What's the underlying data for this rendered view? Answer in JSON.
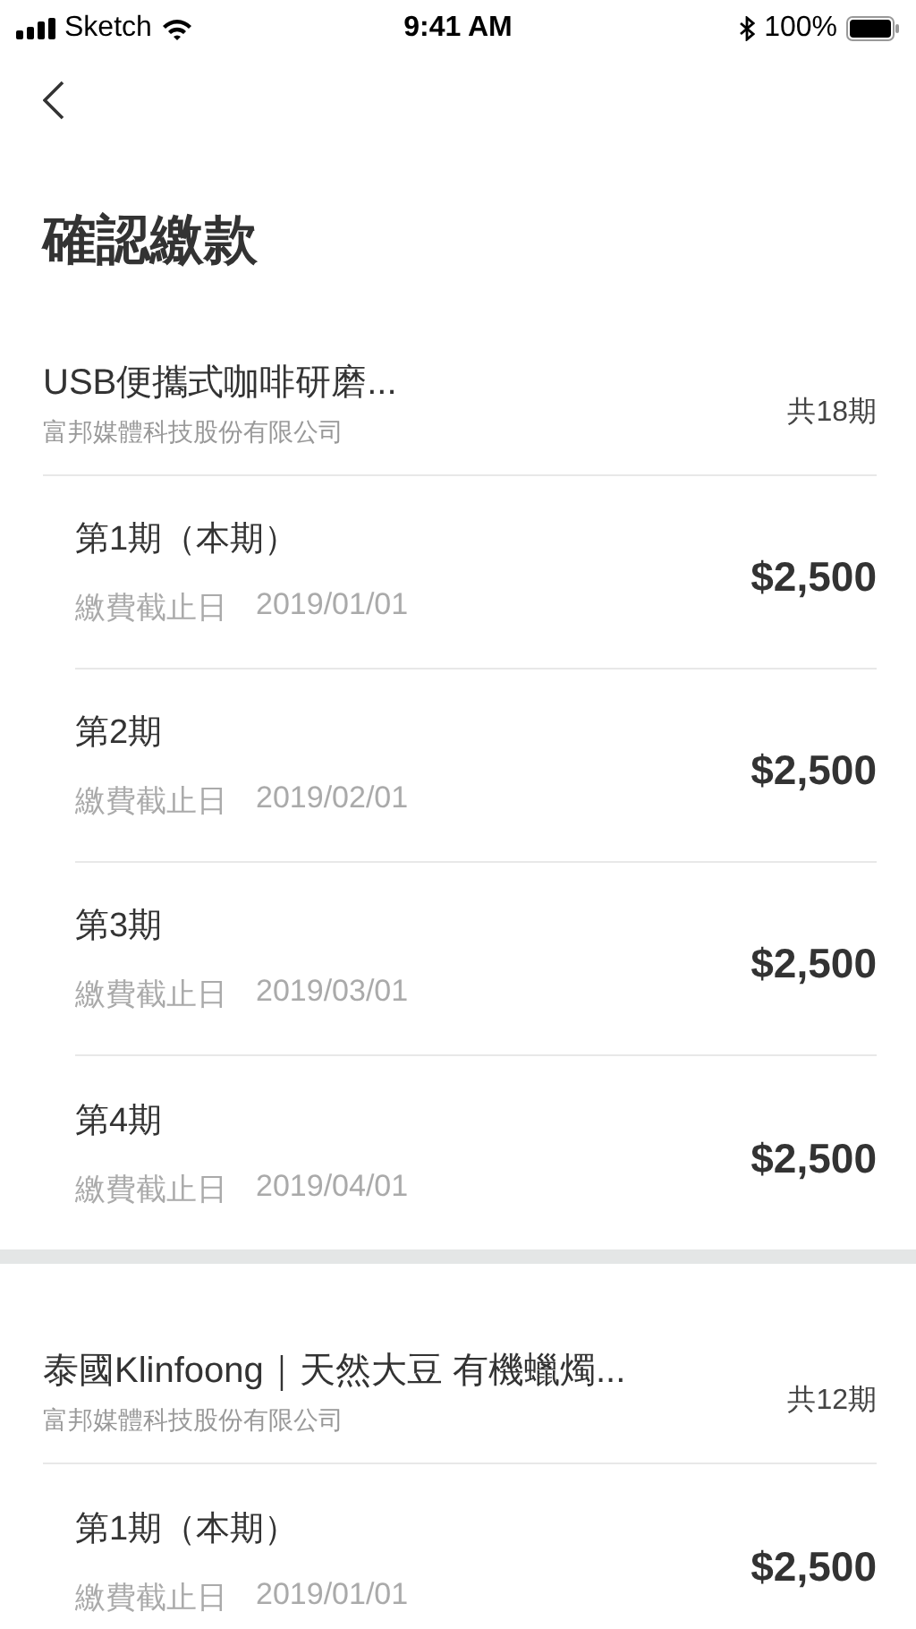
{
  "status_bar": {
    "carrier": "Sketch",
    "time": "9:41 AM",
    "battery": "100%"
  },
  "title": "確認繳款",
  "orders": [
    {
      "name": "USB便攜式咖啡研磨...",
      "merchant": "富邦媒體科技股份有限公司",
      "total": "共18期",
      "installments": [
        {
          "label": "第1期（本期）",
          "due_label": "繳費截止日",
          "due_date": "2019/01/01",
          "amount": "$2,500"
        },
        {
          "label": "第2期",
          "due_label": "繳費截止日",
          "due_date": "2019/02/01",
          "amount": "$2,500"
        },
        {
          "label": "第3期",
          "due_label": "繳費截止日",
          "due_date": "2019/03/01",
          "amount": "$2,500"
        },
        {
          "label": "第4期",
          "due_label": "繳費截止日",
          "due_date": "2019/04/01",
          "amount": "$2,500"
        }
      ]
    },
    {
      "name": "泰國Klinfoong｜天然大豆 有機蠟燭...",
      "merchant": "富邦媒體科技股份有限公司",
      "total": "共12期",
      "installments": [
        {
          "label": "第1期（本期）",
          "due_label": "繳費截止日",
          "due_date": "2019/01/01",
          "amount": "$2,500"
        }
      ]
    }
  ]
}
